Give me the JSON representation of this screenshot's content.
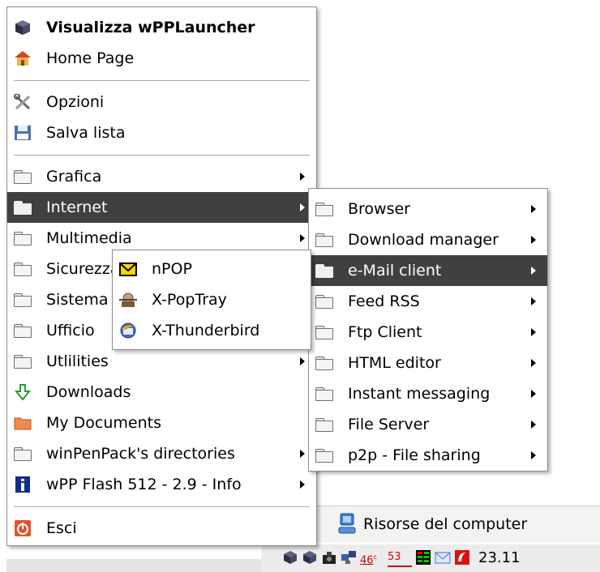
{
  "main_menu": {
    "items": [
      {
        "label": "Visualizza wPPLauncher",
        "icon": "cube-icon"
      },
      {
        "label": "Home Page",
        "icon": "home-icon"
      },
      {
        "label": "Opzioni",
        "icon": "tools-icon"
      },
      {
        "label": "Salva lista",
        "icon": "floppy-disk-icon"
      },
      {
        "label": "Grafica",
        "icon": "folder-icon"
      },
      {
        "label": "Internet",
        "icon": "folder-icon"
      },
      {
        "label": "Multimedia",
        "icon": "folder-icon"
      },
      {
        "label": "Sicurezza",
        "icon": "folder-icon"
      },
      {
        "label": "Sistema",
        "icon": "folder-icon"
      },
      {
        "label": "Ufficio",
        "icon": "folder-icon"
      },
      {
        "label": "Utlilities",
        "icon": "folder-icon"
      },
      {
        "label": "Downloads",
        "icon": "download-arrow-icon"
      },
      {
        "label": "My Documents",
        "icon": "orange-folder-icon"
      },
      {
        "label": "winPenPack's directories",
        "icon": "folder-icon"
      },
      {
        "label": "wPP Flash 512 - 2.9 - Info",
        "icon": "info-icon"
      },
      {
        "label": "Esci",
        "icon": "power-icon"
      }
    ]
  },
  "internet_submenu": {
    "items": [
      {
        "label": "Browser"
      },
      {
        "label": "Download manager"
      },
      {
        "label": "e-Mail client"
      },
      {
        "label": "Feed RSS"
      },
      {
        "label": "Ftp Client"
      },
      {
        "label": "HTML editor"
      },
      {
        "label": "Instant messaging"
      },
      {
        "label": "File Server"
      },
      {
        "label": "p2p - File sharing"
      }
    ]
  },
  "email_submenu": {
    "items": [
      {
        "label": "nPOP",
        "icon": "envelope-icon"
      },
      {
        "label": "X-PopTray",
        "icon": "poptray-icon"
      },
      {
        "label": "X-Thunderbird",
        "icon": "thunderbird-icon"
      }
    ]
  },
  "desktop": {
    "risorse_label": "Risorse del computer"
  },
  "taskbar": {
    "tray_badge_1": "46",
    "tray_badge_2": "53",
    "clock": "23.11"
  },
  "colors": {
    "selection": "#404040",
    "menu_bg": "#ffffff",
    "border": "#8d8d8d"
  }
}
